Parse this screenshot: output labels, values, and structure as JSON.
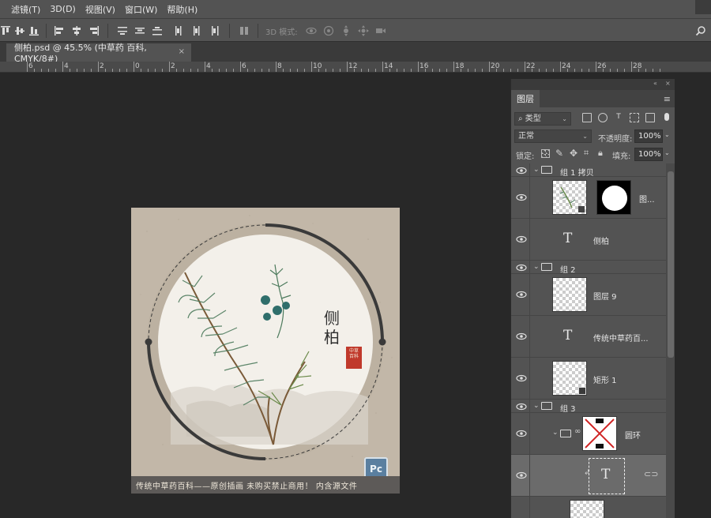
{
  "menubar": {
    "items": [
      "滤镜(T)",
      "3D(D)",
      "视图(V)",
      "窗口(W)",
      "帮助(H)"
    ]
  },
  "optionsbar": {
    "mode_3d_label": "3D 模式:"
  },
  "document": {
    "tab_title": "侧柏.psd @ 45.5% (中草药 百科, CMYK/8#)",
    "close_glyph": "×"
  },
  "ruler": {
    "labels": [
      "6",
      "4",
      "2",
      "0",
      "2",
      "4",
      "6",
      "8",
      "10",
      "12",
      "14",
      "16",
      "18",
      "20",
      "22",
      "24",
      "26",
      "28"
    ]
  },
  "artwork": {
    "title_line1": "侧",
    "title_line2": "柏",
    "seal_text": "中草\n百科",
    "footer_text": "传统中草药百科——原创插画 未购买禁止商用！ 内含源文件",
    "badge_text": "Pc",
    "colors": {
      "paper": "#c2b7a8",
      "inner_circle": "#f3f0ea",
      "ring": "#3a3a3a",
      "seal": "#c0392b",
      "footer": "#5d5a58"
    }
  },
  "layers_panel": {
    "tab_label": "图层",
    "filter_label": "类型",
    "blend_mode": "正常",
    "opacity_label": "不透明度:",
    "opacity_value": "100%",
    "lock_label": "锁定:",
    "fill_label": "填充:",
    "fill_value": "100%",
    "layers": [
      {
        "name": "组 1 拷贝",
        "type": "group",
        "expanded": true
      },
      {
        "name": "图...",
        "type": "image-with-mask"
      },
      {
        "name": "侧柏",
        "type": "text"
      },
      {
        "name": "组 2",
        "type": "group",
        "expanded": true
      },
      {
        "name": "图层 9",
        "type": "image"
      },
      {
        "name": "传统中草药百...",
        "type": "text"
      },
      {
        "name": "矩形 1",
        "type": "shape"
      },
      {
        "name": "组 3",
        "type": "group",
        "expanded": true
      },
      {
        "name": "圆环",
        "type": "group-smart"
      },
      {
        "name": "",
        "type": "text-selected"
      }
    ]
  }
}
